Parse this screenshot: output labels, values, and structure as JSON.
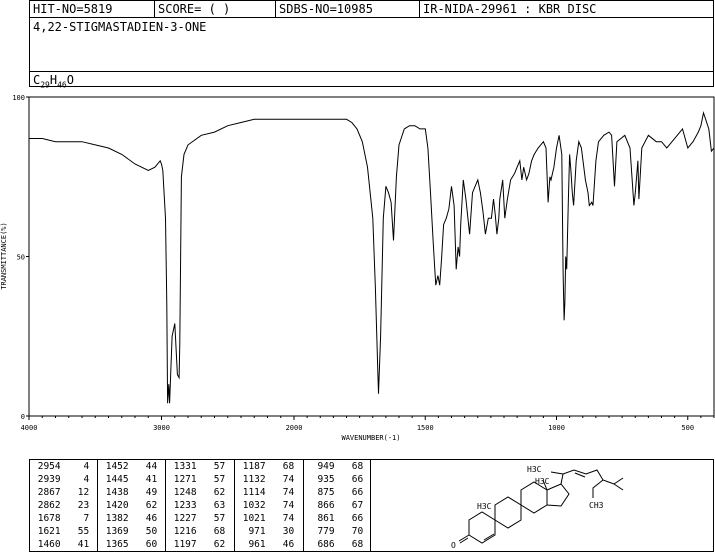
{
  "header": {
    "hit_no": "HIT-NO=5819",
    "score": "SCORE=  (    )",
    "sdbs_no": "SDBS-NO=10985",
    "ir_info": "IR-NIDA-29961 : KBR DISC",
    "compound_name": "4,22-STIGMASTADIEN-3-ONE",
    "formula_parts": [
      "C",
      "29",
      "H",
      "46",
      "O"
    ]
  },
  "chart_data": {
    "type": "line",
    "xlabel": "WAVENUMBER(-1)",
    "ylabel": "TRANSMITTANCE(%)",
    "xlim": [
      4000,
      400
    ],
    "ylim": [
      0,
      100
    ],
    "x_ticks": [
      4000,
      3000,
      2000,
      1500,
      1000,
      500
    ],
    "y_ticks": [
      0,
      50,
      100
    ],
    "x": [
      4000,
      3900,
      3800,
      3700,
      3600,
      3500,
      3400,
      3300,
      3200,
      3100,
      3050,
      3010,
      3000,
      2990,
      2970,
      2960,
      2954,
      2945,
      2939,
      2920,
      2900,
      2880,
      2867,
      2862,
      2850,
      2830,
      2800,
      2700,
      2600,
      2500,
      2400,
      2300,
      2200,
      2100,
      2000,
      1900,
      1850,
      1800,
      1780,
      1760,
      1740,
      1720,
      1700,
      1690,
      1680,
      1678,
      1670,
      1660,
      1650,
      1640,
      1630,
      1621,
      1610,
      1600,
      1580,
      1560,
      1540,
      1520,
      1500,
      1490,
      1480,
      1470,
      1465,
      1460,
      1452,
      1445,
      1438,
      1430,
      1420,
      1410,
      1400,
      1390,
      1382,
      1375,
      1369,
      1365,
      1355,
      1345,
      1331,
      1320,
      1310,
      1300,
      1290,
      1280,
      1271,
      1260,
      1248,
      1240,
      1233,
      1227,
      1220,
      1216,
      1205,
      1197,
      1187,
      1175,
      1160,
      1150,
      1140,
      1132,
      1125,
      1114,
      1105,
      1095,
      1085,
      1070,
      1050,
      1040,
      1032,
      1025,
      1021,
      1010,
      1000,
      990,
      980,
      975,
      971,
      968,
      965,
      961,
      955,
      950,
      945,
      940,
      935,
      925,
      915,
      905,
      890,
      880,
      875,
      866,
      861,
      850,
      840,
      820,
      800,
      790,
      779,
      770,
      740,
      720,
      705,
      700,
      690,
      686,
      675,
      650,
      620,
      600,
      580,
      560,
      540,
      520,
      500,
      480,
      460,
      450,
      440,
      420,
      410,
      400
    ],
    "y": [
      87,
      87,
      86,
      86,
      86,
      85,
      84,
      82,
      79,
      77,
      78,
      80,
      79,
      77,
      62,
      35,
      4,
      10,
      4,
      25,
      29,
      13,
      12,
      23,
      75,
      82,
      85,
      88,
      89,
      91,
      92,
      93,
      93,
      93,
      93,
      93,
      93,
      93,
      92,
      90,
      86,
      78,
      62,
      40,
      12,
      7,
      25,
      62,
      72,
      70,
      67,
      55,
      75,
      85,
      90,
      91,
      91,
      90,
      90,
      84,
      70,
      55,
      48,
      41,
      44,
      41,
      49,
      60,
      62,
      65,
      72,
      66,
      46,
      53,
      50,
      60,
      74,
      68,
      57,
      70,
      72,
      74,
      70,
      64,
      57,
      62,
      62,
      68,
      63,
      57,
      62,
      68,
      74,
      62,
      68,
      74,
      76,
      78,
      80,
      74,
      78,
      74,
      76,
      80,
      82,
      84,
      86,
      84,
      67,
      75,
      74,
      78,
      84,
      88,
      82,
      45,
      30,
      36,
      50,
      46,
      67,
      82,
      77,
      70,
      66,
      80,
      86,
      84,
      74,
      70,
      66,
      67,
      66,
      80,
      86,
      88,
      89,
      88,
      72,
      86,
      88,
      84,
      66,
      70,
      80,
      68,
      84,
      88,
      86,
      86,
      84,
      86,
      88,
      90,
      84,
      86,
      89,
      91,
      95,
      90,
      83,
      84
    ]
  },
  "peak_table": {
    "columns": [
      [
        [
          "2954",
          "4"
        ],
        [
          "2939",
          "4"
        ],
        [
          "2867",
          "12"
        ],
        [
          "2862",
          "23"
        ],
        [
          "1678",
          "7"
        ],
        [
          "1621",
          "55"
        ],
        [
          "1460",
          "41"
        ]
      ],
      [
        [
          "1452",
          "44"
        ],
        [
          "1445",
          "41"
        ],
        [
          "1438",
          "49"
        ],
        [
          "1420",
          "62"
        ],
        [
          "1382",
          "46"
        ],
        [
          "1369",
          "50"
        ],
        [
          "1365",
          "60"
        ]
      ],
      [
        [
          "1331",
          "57"
        ],
        [
          "1271",
          "57"
        ],
        [
          "1248",
          "62"
        ],
        [
          "1233",
          "63"
        ],
        [
          "1227",
          "57"
        ],
        [
          "1216",
          "68"
        ],
        [
          "1197",
          "62"
        ]
      ],
      [
        [
          "1187",
          "68"
        ],
        [
          "1132",
          "74"
        ],
        [
          "1114",
          "74"
        ],
        [
          "1032",
          "74"
        ],
        [
          "1021",
          "74"
        ],
        [
          "971",
          "30"
        ],
        [
          "961",
          "46"
        ]
      ],
      [
        [
          "949",
          "68"
        ],
        [
          "935",
          "66"
        ],
        [
          "875",
          "66"
        ],
        [
          "866",
          "67"
        ],
        [
          "861",
          "66"
        ],
        [
          "779",
          "70"
        ],
        [
          "686",
          "68"
        ]
      ]
    ]
  },
  "structure_labels": {
    "methyl_top": "H3C",
    "methyl_ring": "H3C",
    "methyl_ring2": "H3C",
    "ethyl": "CH3",
    "carbonyl": "O"
  }
}
